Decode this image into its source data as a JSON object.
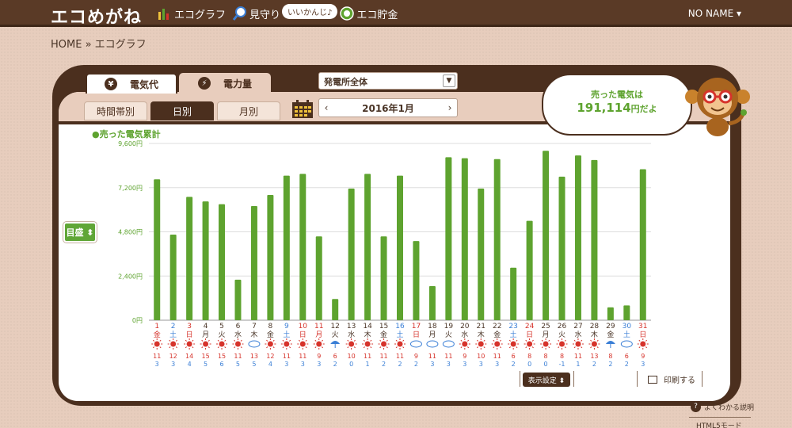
{
  "header": {
    "logo": "エコめがね",
    "nav": [
      {
        "label": "エコグラフ",
        "icon": "bar-chart-icon"
      },
      {
        "label": "見守り",
        "icon": "magnifier-icon",
        "bubble": "いいかんじ♪"
      },
      {
        "label": "エコ貯金",
        "icon": "coin-icon"
      }
    ],
    "user": "NO NAME ▾"
  },
  "breadcrumb": "HOME » エコグラフ",
  "tabs": {
    "cost": "電気代",
    "power": "電力量"
  },
  "plant_select": "発電所全体",
  "period_tabs": {
    "hour": "時間帯別",
    "day": "日別",
    "month": "月別"
  },
  "date_nav": {
    "prev": "‹",
    "label": "2016年1月",
    "next": "›"
  },
  "legend": "●売った電気累計",
  "goal_button": "目盛 ⬍",
  "speech": {
    "line1": "売った電気は",
    "amount": "191,114",
    "unit": "円だよ"
  },
  "display_settings": "表示設定 ⬍",
  "print_label": "印刷する",
  "faq_label": "よくわかる説明",
  "html5_label": "HTML5モード",
  "colors": {
    "bar": "#5ea32f",
    "weekday": "#4a3527",
    "saturday": "#3b7fd6",
    "sunday": "#d6332b"
  },
  "chart_data": {
    "type": "bar",
    "ylim": [
      0,
      9600
    ],
    "yticks": [
      "0円",
      "2,400円",
      "4,800円",
      "7,200円",
      "9,600円"
    ],
    "days": [
      "1",
      "2",
      "3",
      "4",
      "5",
      "6",
      "7",
      "8",
      "9",
      "10",
      "11",
      "12",
      "13",
      "14",
      "15",
      "16",
      "17",
      "18",
      "19",
      "20",
      "21",
      "22",
      "23",
      "24",
      "25",
      "26",
      "27",
      "28",
      "29",
      "30",
      "31"
    ],
    "weekdays": [
      "金",
      "土",
      "日",
      "月",
      "火",
      "水",
      "木",
      "金",
      "土",
      "日",
      "月",
      "火",
      "水",
      "木",
      "金",
      "土",
      "日",
      "月",
      "火",
      "水",
      "木",
      "金",
      "土",
      "日",
      "月",
      "火",
      "水",
      "木",
      "金",
      "土",
      "日"
    ],
    "day_colors": [
      "sunday",
      "saturday",
      "sunday",
      "weekday",
      "weekday",
      "weekday",
      "weekday",
      "weekday",
      "saturday",
      "sunday",
      "sunday",
      "weekday",
      "weekday",
      "weekday",
      "weekday",
      "saturday",
      "sunday",
      "weekday",
      "weekday",
      "weekday",
      "weekday",
      "weekday",
      "saturday",
      "sunday",
      "weekday",
      "weekday",
      "weekday",
      "weekday",
      "weekday",
      "saturday",
      "sunday"
    ],
    "values": [
      7650,
      4650,
      6700,
      6450,
      6300,
      2200,
      6200,
      6800,
      7850,
      7950,
      4550,
      1150,
      7150,
      7950,
      4550,
      7850,
      4300,
      1850,
      8850,
      8800,
      7150,
      8750,
      2850,
      5400,
      9200,
      7800,
      8950,
      8700,
      700,
      800,
      8200
    ],
    "weather": [
      "sun",
      "sun-cloud",
      "sun",
      "sun",
      "sun",
      "sun",
      "cloud-sun",
      "sun",
      "sun",
      "sun",
      "sun",
      "rain",
      "sun",
      "sun",
      "sun",
      "sun",
      "cloud-rain",
      "cloud-rain",
      "cloud-rain",
      "sun",
      "sun",
      "sun",
      "sun-cloud",
      "sun",
      "sun",
      "sun",
      "sun",
      "sun",
      "rain",
      "cloud",
      "sun"
    ],
    "temp_high": [
      "11",
      "12",
      "14",
      "15",
      "15",
      "11",
      "13",
      "12",
      "11",
      "11",
      "9",
      "6",
      "10",
      "11",
      "11",
      "11",
      "9",
      "11",
      "11",
      "9",
      "10",
      "11",
      "6",
      "8",
      "8",
      "8",
      "11",
      "13",
      "8",
      "6",
      "9"
    ],
    "temp_low": [
      "3",
      "3",
      "4",
      "5",
      "6",
      "5",
      "5",
      "4",
      "3",
      "3",
      "3",
      "2",
      "0",
      "1",
      "2",
      "2",
      "2",
      "3",
      "3",
      "3",
      "3",
      "3",
      "2",
      "0",
      "0",
      "-1",
      "1",
      "2",
      "2",
      "2",
      "3"
    ]
  }
}
